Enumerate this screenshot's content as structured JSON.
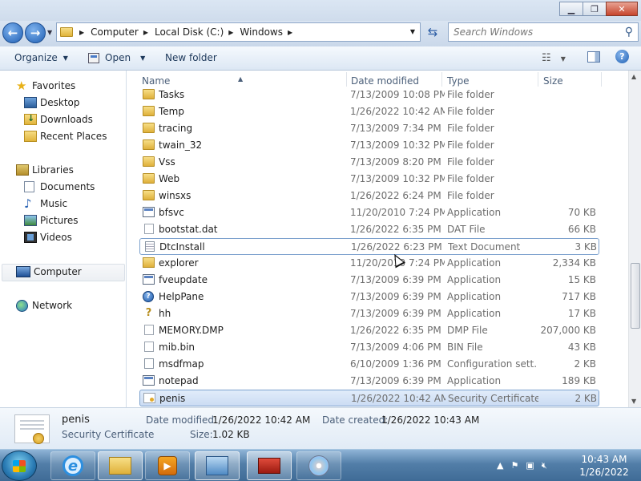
{
  "address": {
    "crumbs": [
      "Computer",
      "Local Disk (C:)",
      "Windows"
    ],
    "search_placeholder": "Search Windows"
  },
  "toolbar": {
    "organize": "Organize",
    "open": "Open",
    "new_folder": "New folder"
  },
  "nav": {
    "favorites": "Favorites",
    "desktop": "Desktop",
    "downloads": "Downloads",
    "recent": "Recent Places",
    "libraries": "Libraries",
    "documents": "Documents",
    "music": "Music",
    "pictures": "Pictures",
    "videos": "Videos",
    "computer": "Computer",
    "network": "Network"
  },
  "columns": {
    "name": "Name",
    "date": "Date modified",
    "type": "Type",
    "size": "Size"
  },
  "files": [
    {
      "name": "Tasks",
      "date": "7/13/2009 10:08 PM",
      "type": "File folder",
      "size": "",
      "icon": "folder-icon"
    },
    {
      "name": "Temp",
      "date": "1/26/2022 10:42 AM",
      "type": "File folder",
      "size": "",
      "icon": "folder-icon"
    },
    {
      "name": "tracing",
      "date": "7/13/2009 7:34 PM",
      "type": "File folder",
      "size": "",
      "icon": "folder-icon"
    },
    {
      "name": "twain_32",
      "date": "7/13/2009 10:32 PM",
      "type": "File folder",
      "size": "",
      "icon": "folder-icon"
    },
    {
      "name": "Vss",
      "date": "7/13/2009 8:20 PM",
      "type": "File folder",
      "size": "",
      "icon": "folder-icon"
    },
    {
      "name": "Web",
      "date": "7/13/2009 10:32 PM",
      "type": "File folder",
      "size": "",
      "icon": "folder-icon"
    },
    {
      "name": "winsxs",
      "date": "1/26/2022 6:24 PM",
      "type": "File folder",
      "size": "",
      "icon": "folder-icon"
    },
    {
      "name": "bfsvc",
      "date": "11/20/2010 7:24 PM",
      "type": "Application",
      "size": "70 KB",
      "icon": "application-icon"
    },
    {
      "name": "bootstat.dat",
      "date": "1/26/2022 6:35 PM",
      "type": "DAT File",
      "size": "66 KB",
      "icon": "file-icon"
    },
    {
      "name": "DtcInstall",
      "date": "1/26/2022 6:23 PM",
      "type": "Text Document",
      "size": "3 KB",
      "icon": "text-document-icon"
    },
    {
      "name": "explorer",
      "date": "11/20/2010 7:24 PM",
      "type": "Application",
      "size": "2,334 KB",
      "icon": "explorer-icon"
    },
    {
      "name": "fveupdate",
      "date": "7/13/2009 6:39 PM",
      "type": "Application",
      "size": "15 KB",
      "icon": "application-icon"
    },
    {
      "name": "HelpPane",
      "date": "7/13/2009 6:39 PM",
      "type": "Application",
      "size": "717 KB",
      "icon": "help-icon"
    },
    {
      "name": "hh",
      "date": "7/13/2009 6:39 PM",
      "type": "Application",
      "size": "17 KB",
      "icon": "help-book-icon"
    },
    {
      "name": "MEMORY.DMP",
      "date": "1/26/2022 6:35 PM",
      "type": "DMP File",
      "size": "207,000 KB",
      "icon": "file-icon"
    },
    {
      "name": "mib.bin",
      "date": "7/13/2009 4:06 PM",
      "type": "BIN File",
      "size": "43 KB",
      "icon": "file-icon"
    },
    {
      "name": "msdfmap",
      "date": "6/10/2009 1:36 PM",
      "type": "Configuration sett...",
      "size": "2 KB",
      "icon": "config-file-icon"
    },
    {
      "name": "notepad",
      "date": "7/13/2009 6:39 PM",
      "type": "Application",
      "size": "189 KB",
      "icon": "notepad-icon"
    },
    {
      "name": "penis",
      "date": "1/26/2022 10:42 AM",
      "type": "Security Certificate",
      "size": "2 KB",
      "icon": "certificate-icon"
    }
  ],
  "details": {
    "name": "penis",
    "type": "Security Certificate",
    "modified_label": "Date modified:",
    "modified_value": "1/26/2022 10:42 AM",
    "created_label": "Date created:",
    "created_value": "1/26/2022 10:43 AM",
    "size_label": "Size:",
    "size_value": "1.02 KB"
  },
  "clock": {
    "time": "10:43 AM",
    "date": "1/26/2022"
  },
  "colors": {
    "selection_border": "#7da2ce",
    "taskbar": "#527ea8"
  }
}
